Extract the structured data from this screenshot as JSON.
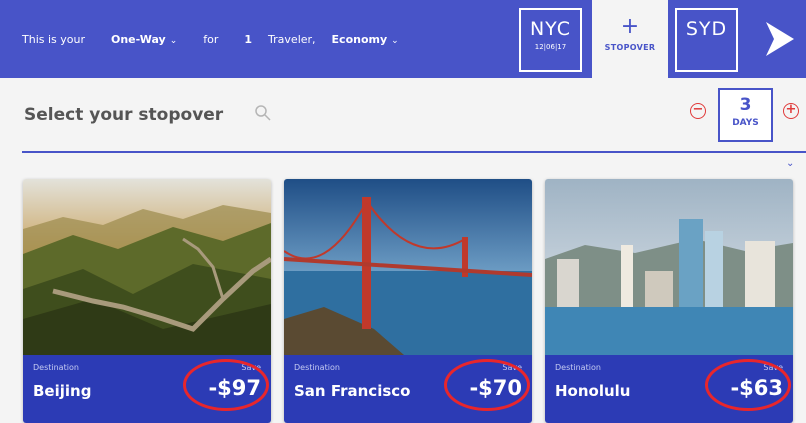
{
  "header": {
    "prefix": "This is your",
    "trip_type": "One-Way",
    "for_label": "for",
    "travelers_count": "1",
    "travelers_label": "Traveler,",
    "cabin_class": "Economy",
    "origin_code": "NYC",
    "origin_date": "12|06|17",
    "stopover_symbol": "+",
    "stopover_label": "STOPOVER",
    "destination_code": "SYD"
  },
  "selector": {
    "title": "Select your stopover",
    "minus_symbol": "−",
    "plus_symbol": "+",
    "days_value": "3",
    "days_unit": "DAYS"
  },
  "destinations": [
    {
      "label": "Destination",
      "city": "Beijing",
      "save_label": "Save",
      "price": "-$97"
    },
    {
      "label": "Destination",
      "city": "San Francisco",
      "save_label": "Save",
      "price": "-$70"
    },
    {
      "label": "Destination",
      "city": "Honolulu",
      "save_label": "Save",
      "price": "-$63"
    }
  ],
  "colors": {
    "brand_blue": "#4854c8",
    "card_footer_blue": "#2c3bb5",
    "highlight_red": "#e8262c"
  }
}
